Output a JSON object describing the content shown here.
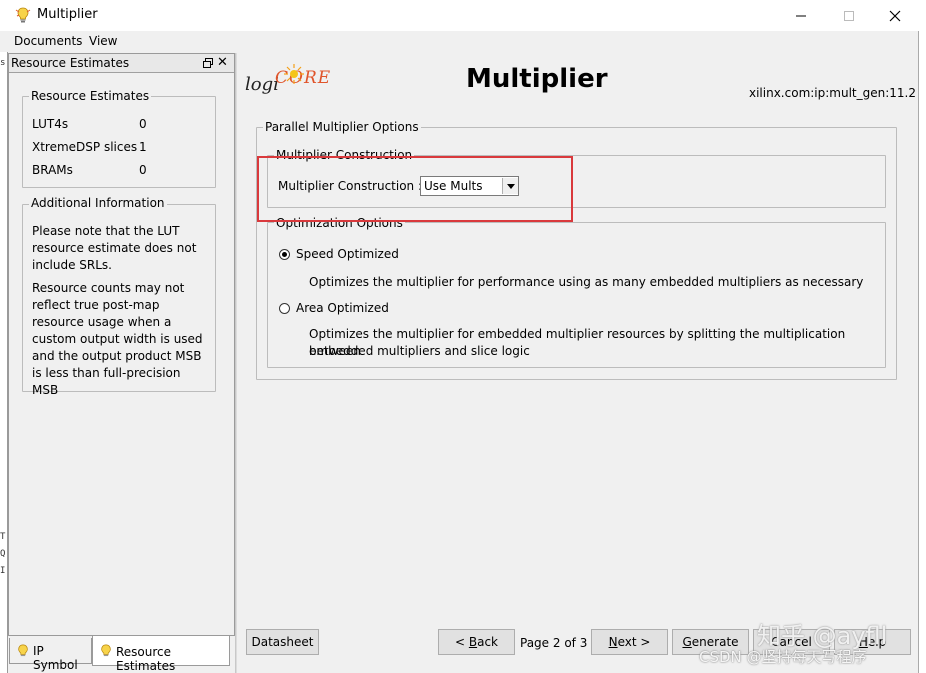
{
  "window": {
    "title": "Multiplier",
    "icon": "bulb-icon",
    "controls": {
      "minimize": "—",
      "maximize": "☐",
      "close": "✕"
    }
  },
  "menu": [
    {
      "label": "Documents"
    },
    {
      "label": "View"
    }
  ],
  "left_strip_chars": [
    "s",
    "T",
    "Q",
    "I"
  ],
  "left_panel": {
    "title": "Resource Estimates",
    "close_glyph": "✕",
    "resource_group": {
      "legend": "Resource Estimates",
      "rows": [
        {
          "name": "LUT4s",
          "value": "0"
        },
        {
          "name": "XtremeDSP slices",
          "value": "1"
        },
        {
          "name": "BRAMs",
          "value": "0"
        }
      ]
    },
    "info_group": {
      "legend": "Additional Information",
      "paragraph1": "Please note that the LUT resource estimate does not include SRLs.",
      "paragraph2": "Resource counts may not reflect true post-map resource usage when a custom output width is used and the output product MSB is less than full-precision MSB"
    }
  },
  "tabs": [
    {
      "label": "IP Symbol",
      "active": false
    },
    {
      "label": "Resource Estimates",
      "active": true
    }
  ],
  "header": {
    "logo_text_logi": "logi",
    "logo_text_core": "CORE",
    "title": "Multiplier",
    "ip_version": "xilinx.com:ip:mult_gen:11.2"
  },
  "parallel_group": {
    "legend": "Parallel Multiplier Options",
    "construction": {
      "legend": "Multiplier Construction",
      "label": "Multiplier Construction :",
      "selected": "Use Mults"
    },
    "optimization": {
      "legend": "Optimization Options",
      "options": [
        {
          "label": "Speed Optimized",
          "selected": true,
          "desc_line1": "Optimizes the multiplier for performance using as many embedded multipliers as necessary",
          "desc_line2": ""
        },
        {
          "label": "Area Optimized",
          "selected": false,
          "desc_line1": "Optimizes the multiplier for embedded multiplier resources by splitting the multiplication between",
          "desc_line2": "embedded multipliers and slice logic"
        }
      ]
    }
  },
  "footer": {
    "datasheet": "Datasheet",
    "back_mnemonic": "B",
    "back_rest": "ack",
    "back_prefix": "< ",
    "page": "Page 2 of 3",
    "next_mnemonic": "N",
    "next_rest": "ext >",
    "generate_mnemonic": "G",
    "generate_rest": "enerate",
    "cancel": "Cancel",
    "help_mnemonic": "H",
    "help_rest": "elp"
  },
  "watermark": {
    "line1": "知乎 @ayfll",
    "line2": "CSDN @坚持每天写程序"
  },
  "colors": {
    "highlight": "#d9393c",
    "window_bg": "#f0f0f0"
  }
}
